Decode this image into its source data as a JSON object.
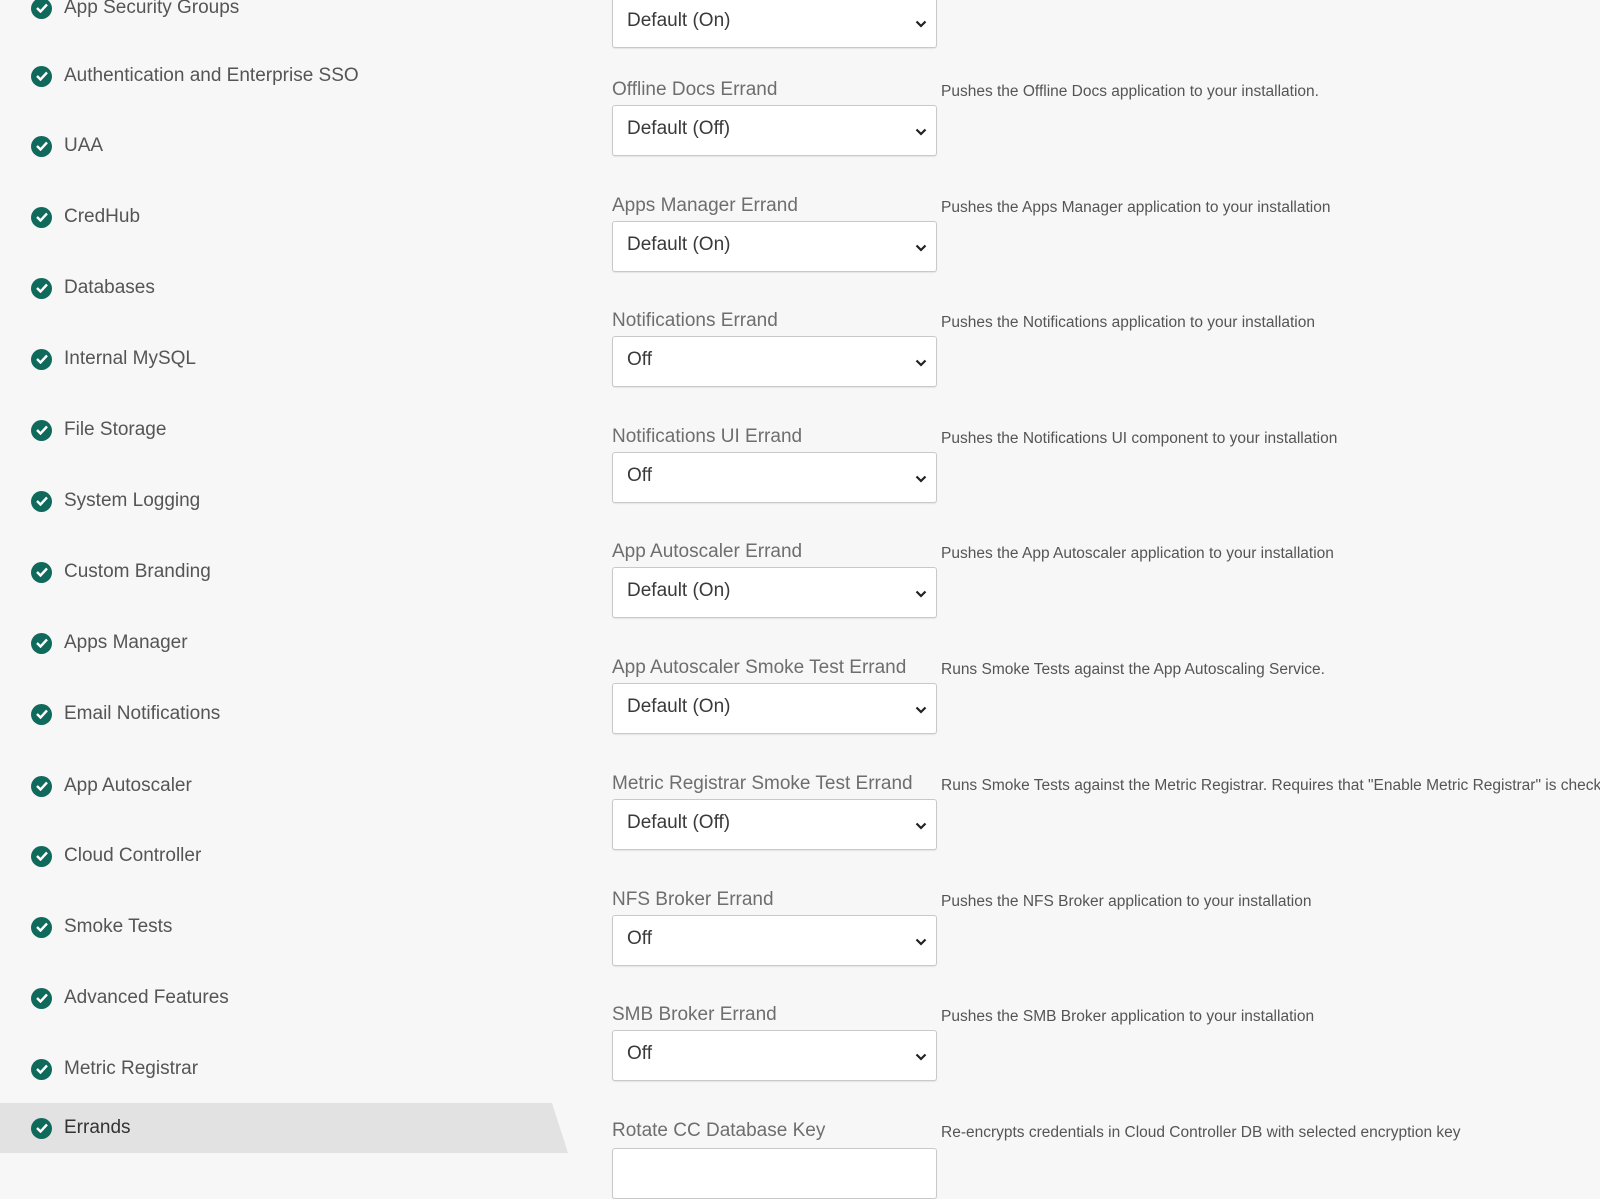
{
  "sidebar": {
    "items": [
      {
        "label": "App Security Groups"
      },
      {
        "label": "Authentication and Enterprise SSO"
      },
      {
        "label": "UAA"
      },
      {
        "label": "CredHub"
      },
      {
        "label": "Databases"
      },
      {
        "label": "Internal MySQL"
      },
      {
        "label": "File Storage"
      },
      {
        "label": "System Logging"
      },
      {
        "label": "Custom Branding"
      },
      {
        "label": "Apps Manager"
      },
      {
        "label": "Email Notifications"
      },
      {
        "label": "App Autoscaler"
      },
      {
        "label": "Cloud Controller"
      },
      {
        "label": "Smoke Tests"
      },
      {
        "label": "Advanced Features"
      },
      {
        "label": "Metric Registrar"
      },
      {
        "label": "Errands",
        "active": true
      }
    ]
  },
  "errands": [
    {
      "label": "",
      "value": "Default (On)",
      "description": ""
    },
    {
      "label": "Offline Docs Errand",
      "value": "Default (Off)",
      "description": "Pushes the Offline Docs application to your installation."
    },
    {
      "label": "Apps Manager Errand",
      "value": "Default (On)",
      "description": "Pushes the Apps Manager application to your installation"
    },
    {
      "label": "Notifications Errand",
      "value": "Off",
      "description": "Pushes the Notifications application to your installation"
    },
    {
      "label": "Notifications UI Errand",
      "value": "Off",
      "description": "Pushes the Notifications UI component to your installation"
    },
    {
      "label": "App Autoscaler Errand",
      "value": "Default (On)",
      "description": "Pushes the App Autoscaler application to your installation"
    },
    {
      "label": "App Autoscaler Smoke Test Errand",
      "value": "Default (On)",
      "description": "Runs Smoke Tests against the App Autoscaling Service."
    },
    {
      "label": "Metric Registrar Smoke Test Errand",
      "value": "Default (Off)",
      "description": "Runs Smoke Tests against the Metric Registrar. Requires that \"Enable Metric Registrar\" is checked"
    },
    {
      "label": "NFS Broker Errand",
      "value": "Off",
      "description": "Pushes the NFS Broker application to your installation"
    },
    {
      "label": "SMB Broker Errand",
      "value": "Off",
      "description": "Pushes the SMB Broker application to your installation"
    },
    {
      "label": "Rotate CC Database Key",
      "value": "",
      "description": "Re-encrypts credentials in Cloud Controller DB with selected encryption key"
    }
  ],
  "icons": {
    "status": "check-circle-icon",
    "dropdown": "chevron-down-icon"
  },
  "colors": {
    "check": "#0f6a5b",
    "active_bg": "#e2e2e2",
    "page_bg": "#f7f7f7"
  }
}
